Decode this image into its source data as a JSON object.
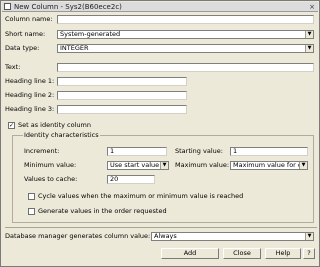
{
  "window": {
    "title": "New Column - Sys2(B60ece2c)",
    "close_glyph": "×"
  },
  "form": {
    "column_name_label": "Column name:",
    "column_name_value": "",
    "short_name_label": "Short name:",
    "short_name_value": "System-generated",
    "data_type_label": "Data type:",
    "data_type_value": "INTEGER",
    "text_label": "Text:",
    "text_value": "",
    "heading1_label": "Heading line 1:",
    "heading2_label": "Heading line 2:",
    "heading3_label": "Heading line 3:",
    "identity_checkbox_label": "Set as identity column",
    "identity_checked": true
  },
  "identity": {
    "group_title": "Identity characteristics",
    "increment_label": "Increment:",
    "increment_value": "1",
    "starting_label": "Starting value:",
    "starting_value": "1",
    "minimum_label": "Minimum value:",
    "minimum_value": "Use start value",
    "maximum_label": "Maximum value:",
    "maximum_value": "Maximum value for data type",
    "cache_label": "Values to cache:",
    "cache_value": "20",
    "cycle_label": "Cycle values when the maximum or minimum value is reached",
    "order_label": "Generate values in the order requested"
  },
  "footer": {
    "generates_label": "Database manager generates column value:",
    "generates_value": "Always",
    "add_label": "Add",
    "close_label": "Close",
    "help_label": "Help",
    "help_q_label": "?"
  },
  "glyphs": {
    "dropdown": "▼",
    "check": "✓"
  }
}
